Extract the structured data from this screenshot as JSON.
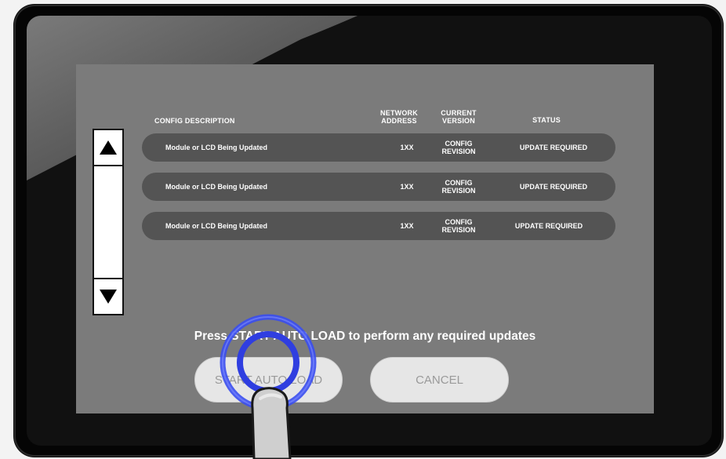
{
  "table": {
    "headers": {
      "config_description": "CONFIG DESCRIPTION",
      "network_address_l1": "NETWORK",
      "network_address_l2": "ADDRESS",
      "current_version_l1": "CURRENT",
      "current_version_l2": "VERSION",
      "status": "STATUS"
    },
    "rows": [
      {
        "description": "Module or LCD Being Updated",
        "address": "1XX",
        "version_l1": "CONFIG",
        "version_l2": "REVISION",
        "status": "UPDATE REQUIRED"
      },
      {
        "description": "Module or LCD Being Updated",
        "address": "1XX",
        "version_l1": "CONFIG",
        "version_l2": "REVISION",
        "status": "UPDATE REQUIRED"
      },
      {
        "description": "Module or LCD Being Updated",
        "address": "1XX",
        "version_l1": "CONFIG",
        "version_l2": "REVISION",
        "status": "UPDATE REQUIRED"
      }
    ]
  },
  "scrollbar": {
    "up_icon": "triangle-up-icon",
    "down_icon": "triangle-down-icon"
  },
  "prompt": "Press START AUTO LOAD  to perform any required updates",
  "buttons": {
    "start": "START AUTO LOAD",
    "cancel": "CANCEL"
  },
  "colors": {
    "screen": "#7b7b7b",
    "row": "#545454",
    "touch_ring": "#3a4ef0",
    "button": "#e6e6e6"
  }
}
